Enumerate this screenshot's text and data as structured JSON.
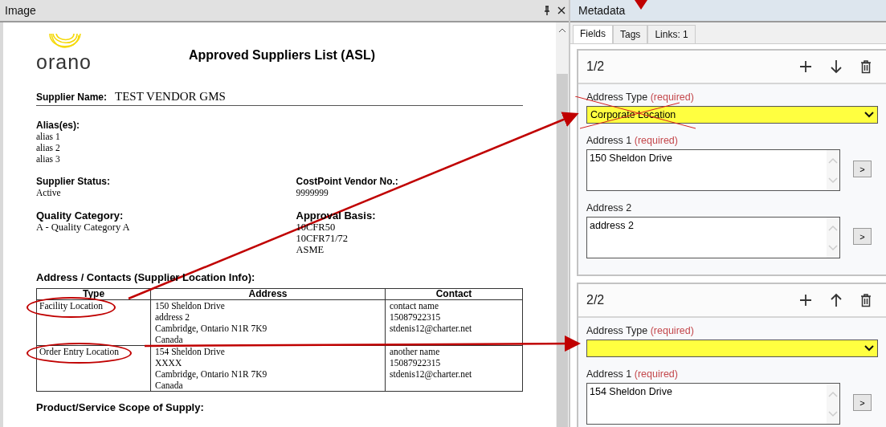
{
  "image_panel": {
    "title": "Image",
    "document": {
      "logo_text": "orano",
      "title": "Approved Suppliers List (ASL)",
      "supplier_name_label": "Supplier Name:",
      "supplier_name": "TEST VENDOR GMS",
      "aliases_label": "Alias(es):",
      "aliases": [
        "alias 1",
        "alias 2",
        "alias 3"
      ],
      "field_rows": [
        [
          {
            "label": "Supplier Status:",
            "values": [
              "Active"
            ]
          },
          {
            "label": "CostPoint Vendor No.:",
            "values": [
              "9999999"
            ]
          }
        ],
        [
          {
            "label": "Quality Category:",
            "values": [
              "A - Quality Category A"
            ]
          },
          {
            "label": "Approval Basis:",
            "values": [
              "10CFR50",
              "10CFR71/72",
              "ASME"
            ]
          }
        ]
      ],
      "address_heading": "Address / Contacts (Supplier Location Info):",
      "table": {
        "columns": [
          "Type",
          "Address",
          "Contact"
        ],
        "rows": [
          {
            "type": "Facility Location",
            "circled": true,
            "address": [
              "150 Sheldon Drive",
              "address 2",
              "Cambridge, Ontario N1R 7K9",
              "Canada"
            ],
            "contact": [
              "contact name",
              "15087922315",
              "stdenis12@charter.net"
            ]
          },
          {
            "type": "Order Entry Location",
            "circled": true,
            "address": [
              "154 Sheldon Drive",
              "XXXX",
              "Cambridge, Ontario N1R 7K9",
              "Canada"
            ],
            "contact": [
              "another name",
              "15087922315",
              "stdenis12@charter.net"
            ]
          }
        ]
      },
      "scope_heading": "Product/Service Scope of Supply:"
    }
  },
  "metadata_panel": {
    "title": "Metadata",
    "tabs": [
      {
        "label": "Fields",
        "selected": true
      },
      {
        "label": "Tags",
        "selected": false
      },
      {
        "label": "Links: 1",
        "selected": false
      }
    ],
    "records": [
      {
        "counter": "1/2",
        "kind": "move-down",
        "fields": [
          {
            "kind": "dropdown",
            "label": "Address Type",
            "required_note": "(required)",
            "value": "Corporate Location",
            "crossed_out": true
          },
          {
            "kind": "textarea",
            "label": "Address 1",
            "required_note": "(required)",
            "value": "150 Sheldon Drive",
            "button": ">"
          },
          {
            "kind": "textarea",
            "label": "Address 2",
            "value": "address 2",
            "button": ">"
          }
        ]
      },
      {
        "counter": "2/2",
        "kind": "move-up",
        "fields": [
          {
            "kind": "dropdown",
            "label": "Address Type",
            "required_note": "(required)",
            "crossed_out": false
          },
          {
            "kind": "textarea",
            "label": "Address 1",
            "required_note": "(required)",
            "value": "154 Sheldon Drive",
            "button": ">"
          }
        ]
      }
    ]
  }
}
